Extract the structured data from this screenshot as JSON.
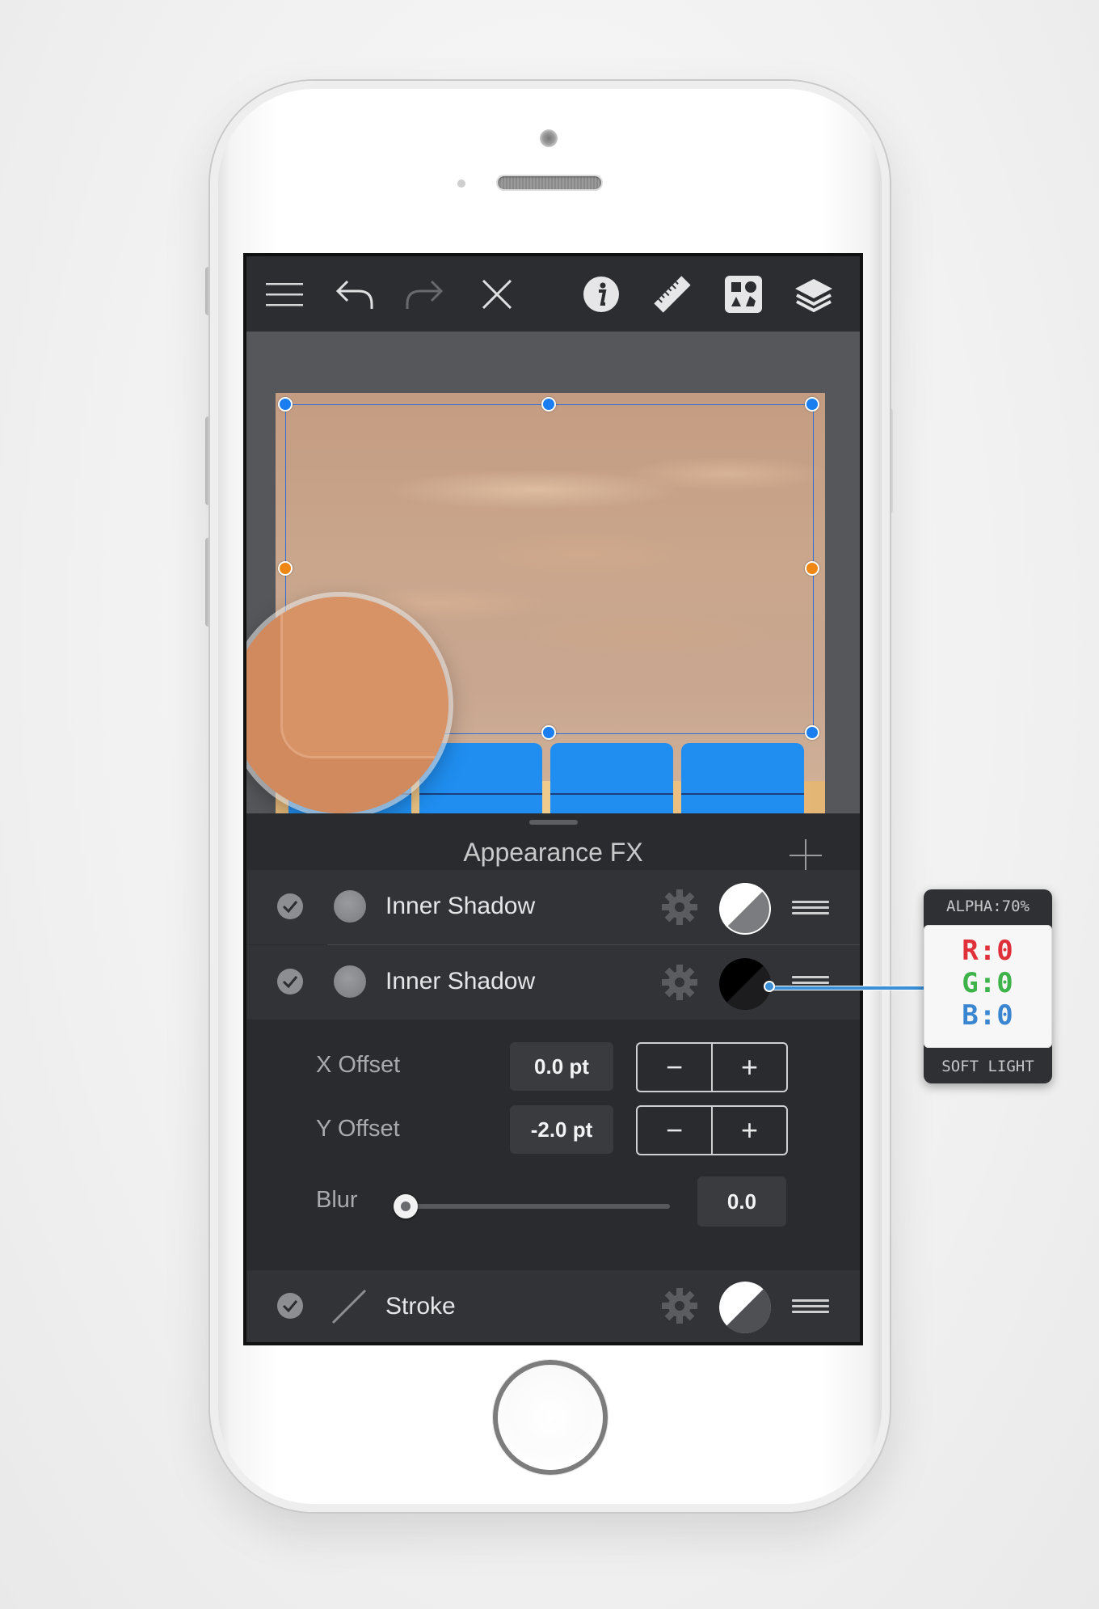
{
  "toolbar": {
    "icons": [
      "menu-icon",
      "undo-icon",
      "redo-icon",
      "close-icon",
      "info-icon",
      "ruler-icon",
      "shapes-icon",
      "layers-icon"
    ]
  },
  "panel": {
    "title": "Appearance FX",
    "effects": [
      {
        "label": "Inner Shadow",
        "enabled": true,
        "swatch": "half-white"
      },
      {
        "label": "Inner Shadow",
        "enabled": true,
        "swatch": "black",
        "expanded": true
      }
    ],
    "params": {
      "x_offset_label": "X Offset",
      "x_offset_value": "0.0 pt",
      "y_offset_label": "Y Offset",
      "y_offset_value": "-2.0 pt",
      "blur_label": "Blur",
      "blur_value": "0.0",
      "minus": "−",
      "plus": "+"
    },
    "stroke": {
      "label": "Stroke",
      "enabled": true
    }
  },
  "callout": {
    "alpha": "ALPHA:70%",
    "r": "R:0",
    "g": "G:0",
    "b": "B:0",
    "blend": "SOFT LIGHT"
  },
  "colors": {
    "handle_blue": "#1a7ef0",
    "handle_orange": "#f08714",
    "tile_blue": "#1f8ef0"
  }
}
